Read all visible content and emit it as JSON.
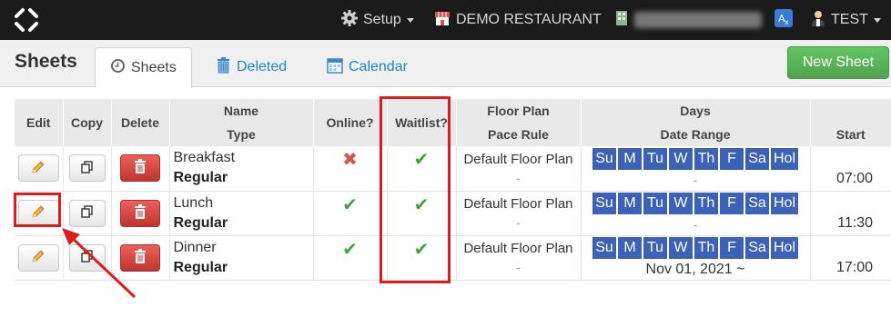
{
  "nav": {
    "setup_label": "Setup",
    "restaurant_label": "DEMO RESTAURANT",
    "user_label": "TEST"
  },
  "header": {
    "title": "Sheets",
    "tabs": [
      {
        "label": "Sheets",
        "active": true
      },
      {
        "label": "Deleted",
        "active": false
      },
      {
        "label": "Calendar",
        "active": false
      }
    ],
    "new_button": "New Sheet"
  },
  "table": {
    "headers": {
      "edit": "Edit",
      "copy": "Copy",
      "delete": "Delete",
      "name": "Name",
      "type": "Type",
      "online": "Online?",
      "waitlist": "Waitlist?",
      "floor_plan": "Floor Plan",
      "pace_rule": "Pace Rule",
      "days": "Days",
      "date_range": "Date Range",
      "start": "Start"
    },
    "day_labels": [
      "Su",
      "M",
      "Tu",
      "W",
      "Th",
      "F",
      "Sa",
      "Hol"
    ],
    "rows": [
      {
        "name": "Breakfast",
        "type": "Regular",
        "online": "no",
        "waitlist": "yes",
        "floor_plan": "Default Floor Plan",
        "pace_rule": "-",
        "date_range": "-",
        "start": "07:00"
      },
      {
        "name": "Lunch",
        "type": "Regular",
        "online": "yes",
        "waitlist": "yes",
        "floor_plan": "Default Floor Plan",
        "pace_rule": "-",
        "date_range": "-",
        "start": "11:30"
      },
      {
        "name": "Dinner",
        "type": "Regular",
        "online": "yes",
        "waitlist": "yes",
        "floor_plan": "Default Floor Plan",
        "pace_rule": "-",
        "date_range": "Nov 01, 2021 ~",
        "start": "17:00"
      }
    ]
  },
  "colors": {
    "nav_bg": "#1b1b1b",
    "day_badge": "#3b62b8",
    "new_button": "#5cb85c",
    "delete_button": "#d9534f",
    "annotation": "#e01b1b"
  }
}
